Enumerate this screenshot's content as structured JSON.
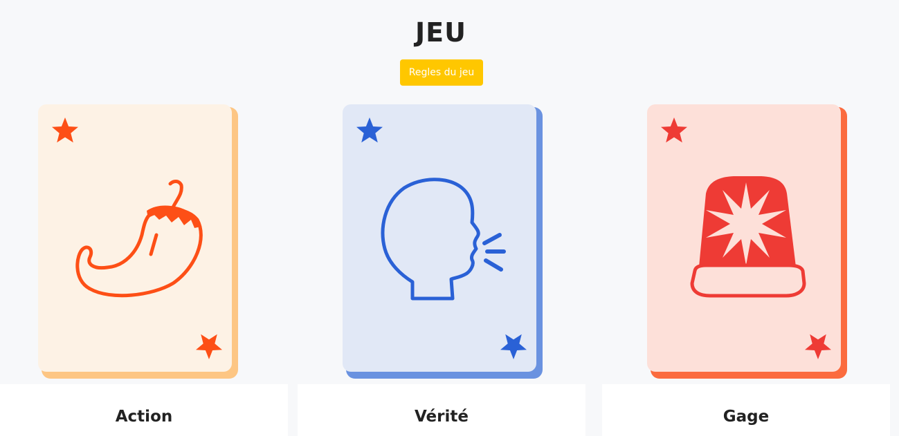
{
  "header": {
    "title": "JEU",
    "rules_button_label": "Regles du jeu"
  },
  "cards": [
    {
      "label": "Action",
      "icon": "chili-pepper-icon",
      "colors": {
        "face": "#fdf2e5",
        "edge": "#fdc684",
        "accent": "#fd4f16"
      }
    },
    {
      "label": "Vérité",
      "icon": "speaking-head-icon",
      "colors": {
        "face": "#e1e8f6",
        "edge": "#6a92e0",
        "accent": "#2a61d6"
      }
    },
    {
      "label": "Gage",
      "icon": "siren-icon",
      "colors": {
        "face": "#fde0d9",
        "edge": "#fb6b3e",
        "accent": "#ee3b35"
      }
    }
  ]
}
